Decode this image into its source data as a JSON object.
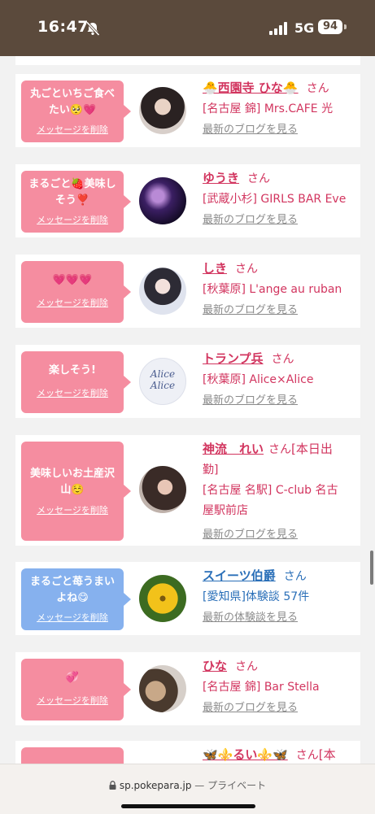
{
  "status": {
    "time": "16:47",
    "network": "5G",
    "battery": "94"
  },
  "rows": [
    {
      "message": "丸ごといちご食べたい🥺💗",
      "delete": "メッセージを削除",
      "name": "🐣西園寺 ひな🐣",
      "honorific": "さん",
      "shop": "[名古屋 錦] Mrs.CAFE 光",
      "link": "最新のブログを見る"
    },
    {
      "message": "まるごと🍓美味しそう❣️",
      "delete": "メッセージを削除",
      "name": "ゆうき",
      "honorific": "さん",
      "shop": "[武蔵小杉] GIRLS BAR Eve",
      "link": "最新のブログを見る"
    },
    {
      "message": "💗💗💗",
      "delete": "メッセージを削除",
      "name": "しき",
      "honorific": "さん",
      "shop": "[秋葉原] L'ange au ruban",
      "link": "最新のブログを見る"
    },
    {
      "message": "楽しそう!",
      "delete": "メッセージを削除",
      "name": "トランプ兵",
      "honorific": "さん",
      "shop": "[秋葉原] Alice×Alice",
      "link": "最新のブログを見る",
      "avatar_text": "Alice Alice"
    },
    {
      "message": "美味しいお土産沢山☺️",
      "delete": "メッセージを削除",
      "name": "神流　れい",
      "honorific": "さん",
      "shop_a": "[本日出",
      "shop_b": "勤]",
      "shop_c": "[名古屋 名駅] C-club 名古",
      "shop_d": "屋駅前店",
      "link": "最新のブログを見る"
    },
    {
      "message": "まるごと苺うまいよね😋",
      "delete": "メッセージを削除",
      "name": "スイーツ伯爵",
      "honorific": "さん",
      "shop": "[愛知県]体験談 57件",
      "link": "最新の体験談を見る"
    },
    {
      "message": "💞",
      "delete": "メッセージを削除",
      "name": "ひな",
      "honorific": "さん",
      "shop": "[名古屋 錦] Bar Stella",
      "link": "最新のブログを見る"
    },
    {
      "name": "🦋⚜️るい⚜️🦋",
      "honorific": "さん",
      "shop": "[本"
    }
  ],
  "browser": {
    "url": "sp.pokepara.jp",
    "mode": "— プライベート"
  },
  "colors": {
    "header": "#5b4a3c",
    "bubble_pink": "#f58da0",
    "bubble_blue": "#86b1ee",
    "name_pink": "#d2355f",
    "name_blue": "#2a6fb8"
  }
}
